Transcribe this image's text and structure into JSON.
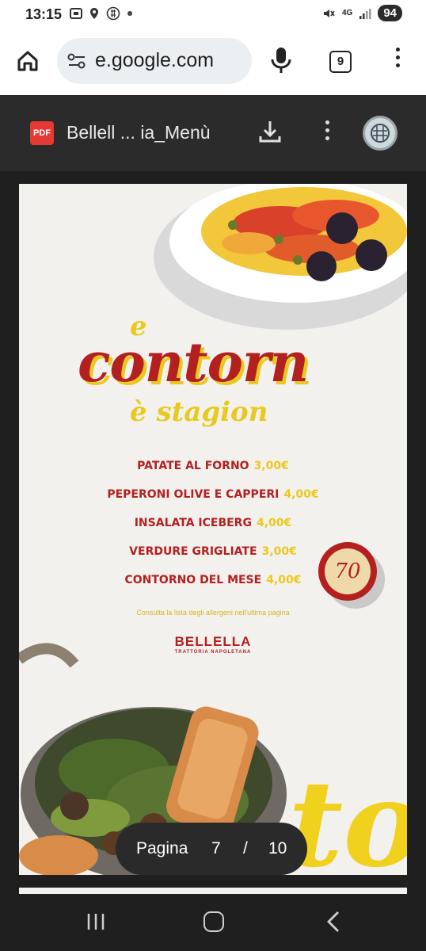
{
  "status_bar": {
    "time": "13:15",
    "network": "4G",
    "battery": "94"
  },
  "browser": {
    "url": "e.google.com",
    "tab_count": "9"
  },
  "pdf_viewer": {
    "badge": "PDF",
    "title": "Bellell ... ia_Menù"
  },
  "menu_page": {
    "heading_e": "e",
    "heading_main": "contorn",
    "heading_sub": "è stagion",
    "items": [
      {
        "name": "PATATE AL FORNO",
        "price": "3,00€"
      },
      {
        "name": "PEPERONI OLIVE E CAPPERI",
        "price": "4,00€"
      },
      {
        "name": "INSALATA ICEBERG",
        "price": "4,00€"
      },
      {
        "name": "VERDURE GRIGLIATE",
        "price": "3,00€"
      },
      {
        "name": "CONTORNO DEL MESE",
        "price": "4,00€"
      }
    ],
    "allergen_note": "Consulta la lista degli allergeni nell'ultima pagina",
    "brand": "BELLELLA",
    "brand_subtitle": "TRATTORIA NAPOLETANA",
    "tombola_number": "70",
    "decor_script": "to"
  },
  "page_indicator": {
    "label": "Pagina",
    "current": "7",
    "separator": "/",
    "total": "10"
  },
  "colors": {
    "brand_red": "#b3201f",
    "brand_yellow": "#e9c91e"
  }
}
